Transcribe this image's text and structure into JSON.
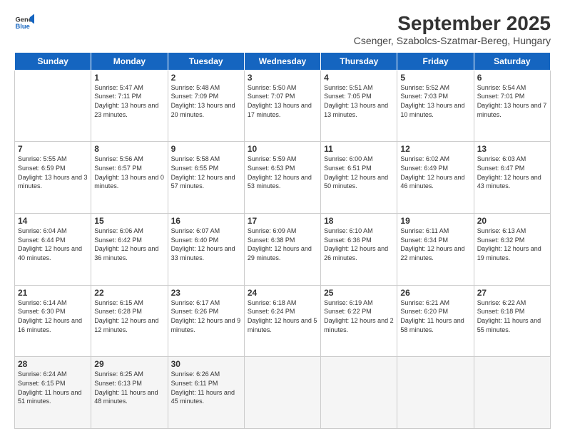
{
  "logo": {
    "line1": "General",
    "line2": "Blue"
  },
  "title": "September 2025",
  "subtitle": "Csenger, Szabolcs-Szatmar-Bereg, Hungary",
  "days_of_week": [
    "Sunday",
    "Monday",
    "Tuesday",
    "Wednesday",
    "Thursday",
    "Friday",
    "Saturday"
  ],
  "weeks": [
    [
      {
        "day": "",
        "info": ""
      },
      {
        "day": "1",
        "info": "Sunrise: 5:47 AM\nSunset: 7:11 PM\nDaylight: 13 hours\nand 23 minutes."
      },
      {
        "day": "2",
        "info": "Sunrise: 5:48 AM\nSunset: 7:09 PM\nDaylight: 13 hours\nand 20 minutes."
      },
      {
        "day": "3",
        "info": "Sunrise: 5:50 AM\nSunset: 7:07 PM\nDaylight: 13 hours\nand 17 minutes."
      },
      {
        "day": "4",
        "info": "Sunrise: 5:51 AM\nSunset: 7:05 PM\nDaylight: 13 hours\nand 13 minutes."
      },
      {
        "day": "5",
        "info": "Sunrise: 5:52 AM\nSunset: 7:03 PM\nDaylight: 13 hours\nand 10 minutes."
      },
      {
        "day": "6",
        "info": "Sunrise: 5:54 AM\nSunset: 7:01 PM\nDaylight: 13 hours\nand 7 minutes."
      }
    ],
    [
      {
        "day": "7",
        "info": "Sunrise: 5:55 AM\nSunset: 6:59 PM\nDaylight: 13 hours\nand 3 minutes."
      },
      {
        "day": "8",
        "info": "Sunrise: 5:56 AM\nSunset: 6:57 PM\nDaylight: 13 hours\nand 0 minutes."
      },
      {
        "day": "9",
        "info": "Sunrise: 5:58 AM\nSunset: 6:55 PM\nDaylight: 12 hours\nand 57 minutes."
      },
      {
        "day": "10",
        "info": "Sunrise: 5:59 AM\nSunset: 6:53 PM\nDaylight: 12 hours\nand 53 minutes."
      },
      {
        "day": "11",
        "info": "Sunrise: 6:00 AM\nSunset: 6:51 PM\nDaylight: 12 hours\nand 50 minutes."
      },
      {
        "day": "12",
        "info": "Sunrise: 6:02 AM\nSunset: 6:49 PM\nDaylight: 12 hours\nand 46 minutes."
      },
      {
        "day": "13",
        "info": "Sunrise: 6:03 AM\nSunset: 6:47 PM\nDaylight: 12 hours\nand 43 minutes."
      }
    ],
    [
      {
        "day": "14",
        "info": "Sunrise: 6:04 AM\nSunset: 6:44 PM\nDaylight: 12 hours\nand 40 minutes."
      },
      {
        "day": "15",
        "info": "Sunrise: 6:06 AM\nSunset: 6:42 PM\nDaylight: 12 hours\nand 36 minutes."
      },
      {
        "day": "16",
        "info": "Sunrise: 6:07 AM\nSunset: 6:40 PM\nDaylight: 12 hours\nand 33 minutes."
      },
      {
        "day": "17",
        "info": "Sunrise: 6:09 AM\nSunset: 6:38 PM\nDaylight: 12 hours\nand 29 minutes."
      },
      {
        "day": "18",
        "info": "Sunrise: 6:10 AM\nSunset: 6:36 PM\nDaylight: 12 hours\nand 26 minutes."
      },
      {
        "day": "19",
        "info": "Sunrise: 6:11 AM\nSunset: 6:34 PM\nDaylight: 12 hours\nand 22 minutes."
      },
      {
        "day": "20",
        "info": "Sunrise: 6:13 AM\nSunset: 6:32 PM\nDaylight: 12 hours\nand 19 minutes."
      }
    ],
    [
      {
        "day": "21",
        "info": "Sunrise: 6:14 AM\nSunset: 6:30 PM\nDaylight: 12 hours\nand 16 minutes."
      },
      {
        "day": "22",
        "info": "Sunrise: 6:15 AM\nSunset: 6:28 PM\nDaylight: 12 hours\nand 12 minutes."
      },
      {
        "day": "23",
        "info": "Sunrise: 6:17 AM\nSunset: 6:26 PM\nDaylight: 12 hours\nand 9 minutes."
      },
      {
        "day": "24",
        "info": "Sunrise: 6:18 AM\nSunset: 6:24 PM\nDaylight: 12 hours\nand 5 minutes."
      },
      {
        "day": "25",
        "info": "Sunrise: 6:19 AM\nSunset: 6:22 PM\nDaylight: 12 hours\nand 2 minutes."
      },
      {
        "day": "26",
        "info": "Sunrise: 6:21 AM\nSunset: 6:20 PM\nDaylight: 11 hours\nand 58 minutes."
      },
      {
        "day": "27",
        "info": "Sunrise: 6:22 AM\nSunset: 6:18 PM\nDaylight: 11 hours\nand 55 minutes."
      }
    ],
    [
      {
        "day": "28",
        "info": "Sunrise: 6:24 AM\nSunset: 6:15 PM\nDaylight: 11 hours\nand 51 minutes."
      },
      {
        "day": "29",
        "info": "Sunrise: 6:25 AM\nSunset: 6:13 PM\nDaylight: 11 hours\nand 48 minutes."
      },
      {
        "day": "30",
        "info": "Sunrise: 6:26 AM\nSunset: 6:11 PM\nDaylight: 11 hours\nand 45 minutes."
      },
      {
        "day": "",
        "info": ""
      },
      {
        "day": "",
        "info": ""
      },
      {
        "day": "",
        "info": ""
      },
      {
        "day": "",
        "info": ""
      }
    ]
  ]
}
